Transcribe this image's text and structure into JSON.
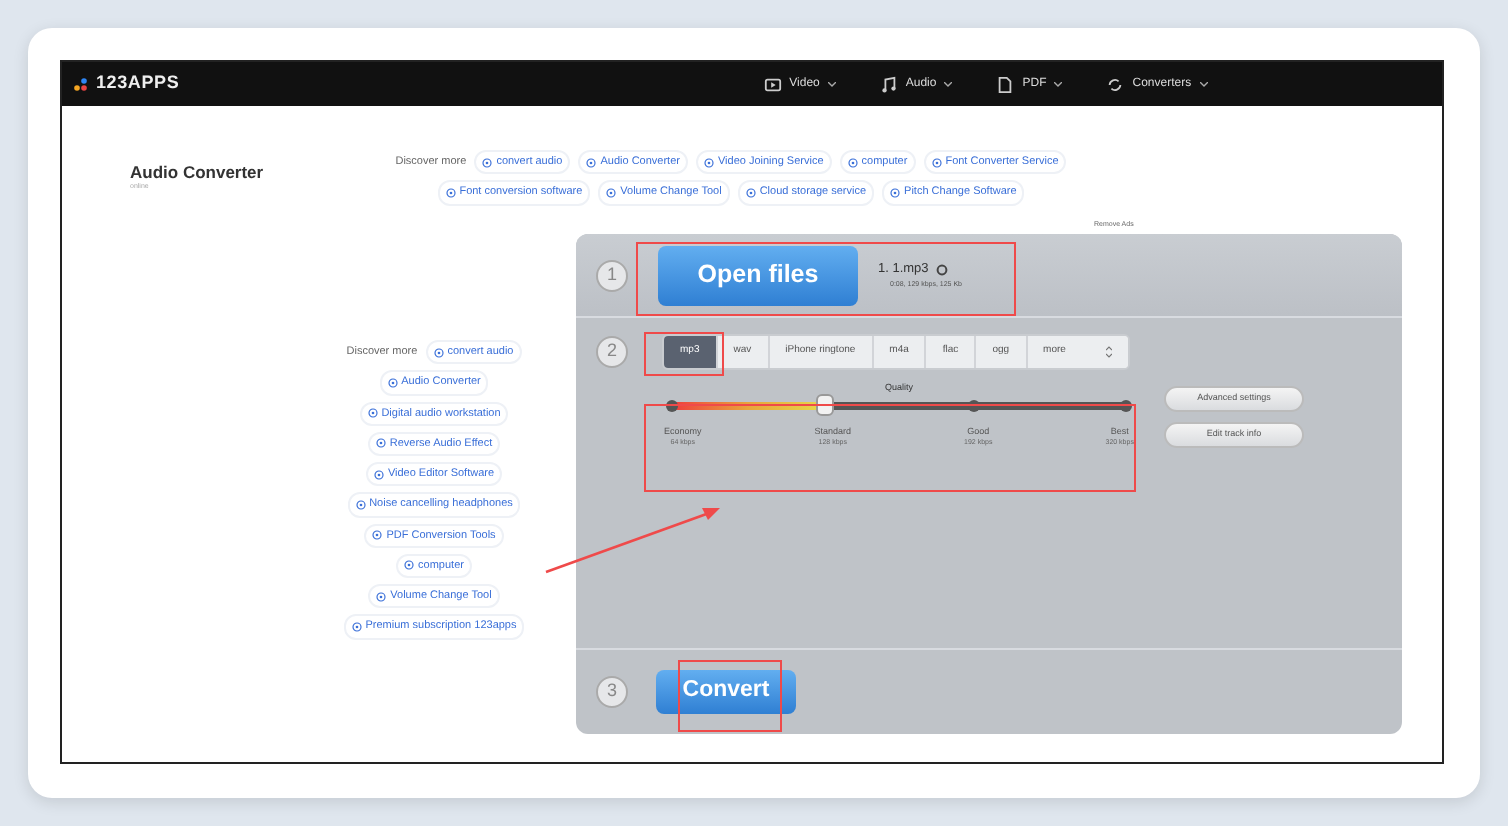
{
  "navbar": {
    "logo": "123APPS",
    "menus": [
      {
        "label": "Video",
        "kind": "video"
      },
      {
        "label": "Audio",
        "kind": "audio"
      },
      {
        "label": "PDF",
        "kind": "pdf"
      },
      {
        "label": "Converters",
        "kind": "converters"
      }
    ]
  },
  "header": {
    "title": "Audio Converter",
    "subtitle": "online",
    "discover_label": "Discover more",
    "links": [
      "convert audio",
      "Audio Converter",
      "Video Joining Service",
      "computer",
      "Font Converter Service",
      "Font conversion software",
      "Volume Change Tool",
      "Cloud storage service",
      "Pitch Change Software"
    ]
  },
  "sidebar": {
    "discover_label": "Discover more",
    "links": [
      "convert audio",
      "Audio Converter",
      "Digital audio workstation",
      "Reverse Audio Effect",
      "Video Editor Software",
      "Noise cancelling headphones",
      "PDF Conversion Tools",
      "computer",
      "Volume Change Tool",
      "Premium subscription 123apps"
    ]
  },
  "remove_ads": "Remove Ads",
  "step1": {
    "number": "1",
    "button": "Open files",
    "file_name": "1. 1.mp3",
    "file_info": "0:08, 129 kbps, 125 Kb"
  },
  "step2": {
    "number": "2",
    "formats": [
      {
        "label": "mp3",
        "selected": true
      },
      {
        "label": "wav",
        "selected": false
      },
      {
        "label": "iPhone ringtone",
        "selected": false
      },
      {
        "label": "m4a",
        "selected": false
      },
      {
        "label": "flac",
        "selected": false
      },
      {
        "label": "ogg",
        "selected": false
      }
    ],
    "more": "more",
    "quality": {
      "label": "Quality",
      "level": 0.333,
      "stops": [
        {
          "name": "Economy",
          "rate": "64 kbps"
        },
        {
          "name": "Standard",
          "rate": "128 kbps"
        },
        {
          "name": "Good",
          "rate": "192 kbps"
        },
        {
          "name": "Best",
          "rate": "320 kbps"
        }
      ]
    },
    "buttons": [
      "Advanced settings",
      "Edit track info"
    ]
  },
  "step3": {
    "number": "3",
    "button": "Convert"
  }
}
